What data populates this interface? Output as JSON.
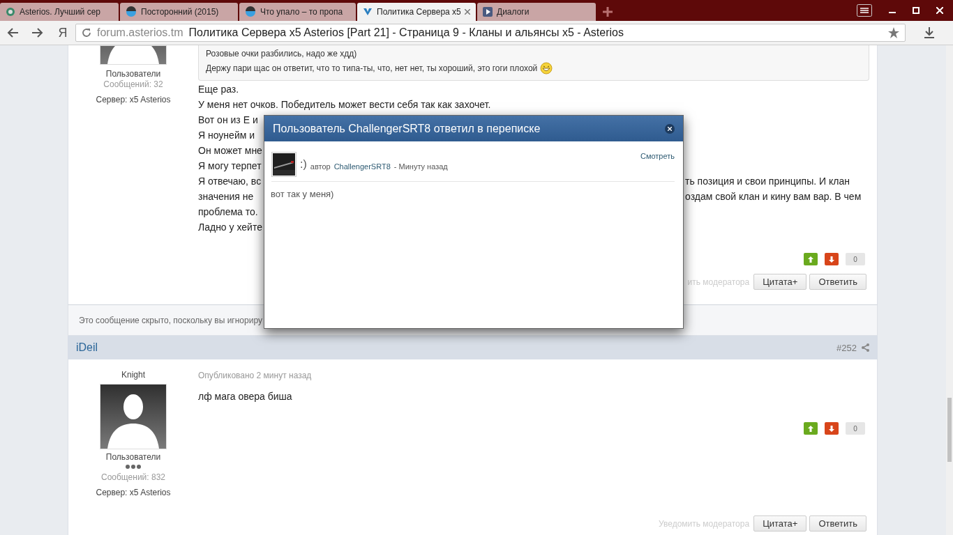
{
  "browser": {
    "tabs": [
      {
        "title": "Asterios. Лучший сер",
        "kind": "site",
        "selected": false
      },
      {
        "title": "Посторонний (2015)",
        "kind": "face",
        "selected": false
      },
      {
        "title": "Что упало – то пропа",
        "kind": "face",
        "selected": false
      },
      {
        "title": "Политика Сервера x5",
        "kind": "forum",
        "selected": true
      },
      {
        "title": "Диалоги",
        "kind": "dialog",
        "selected": false
      }
    ],
    "address": {
      "domain": "forum.asterios.tm",
      "page_title": "Политика Сервера x5 Asterios [Part 21] - Страница 9 - Кланы и альянсы x5 - Asterios"
    },
    "yandex_label": "Я"
  },
  "post_above": {
    "author": {
      "group": "Пользователи",
      "posts": "Сообщений: 32",
      "server": "Сервер: x5 Asterios"
    },
    "quote_lines": [
      "Розовые очки разбились, надо же хдд)",
      "Держу пари щас он ответит, что то типа-ты, что, нет нет, ты хороший, это гоги плохой"
    ],
    "lines": [
      {
        "left": "Еще раз."
      },
      {
        "left": "У меня нет очков. Победитель может вести себя так как захочет."
      },
      {
        "left": "Вот он из Е и"
      },
      {
        "left": "Я ноунейм и"
      },
      {
        "left": "Он может мне"
      },
      {
        "left": "Я могу терпет"
      },
      {
        "left": "Я отвечаю, вс",
        "right": "ть позиция и свои принципы. И клан"
      },
      {
        "left": "значения не",
        "right": "оздам свой клан и кину вам вар. В чем"
      },
      {
        "left": "проблема то."
      },
      {
        "left": "Ладно у хейте"
      }
    ],
    "score": "0",
    "report": "ить модератора",
    "buttons": [
      "Цитата+",
      "Ответить"
    ]
  },
  "hidden_notice": "Это сообщение скрыто, поскольку вы игнориру",
  "post": {
    "author": "iDeil",
    "number": "#252",
    "rank": "Knight",
    "group": "Пользователи",
    "posts": "Сообщений: 832",
    "server": "Сервер: x5 Asterios",
    "published": "Опубликовано 2 минут назад",
    "text": "лф мага овера биша",
    "score": "0",
    "report": "Уведомить модератора",
    "buttons": [
      "Цитата+",
      "Ответить"
    ]
  },
  "dialog": {
    "title": "Пользователь ChallengerSRT8 ответил в переписке",
    "smiley": ":)",
    "by": "автор",
    "user": "ChallengerSRT8",
    "time": "- Минуту назад",
    "view": "Смотреть",
    "message": "вот так у меня)"
  }
}
